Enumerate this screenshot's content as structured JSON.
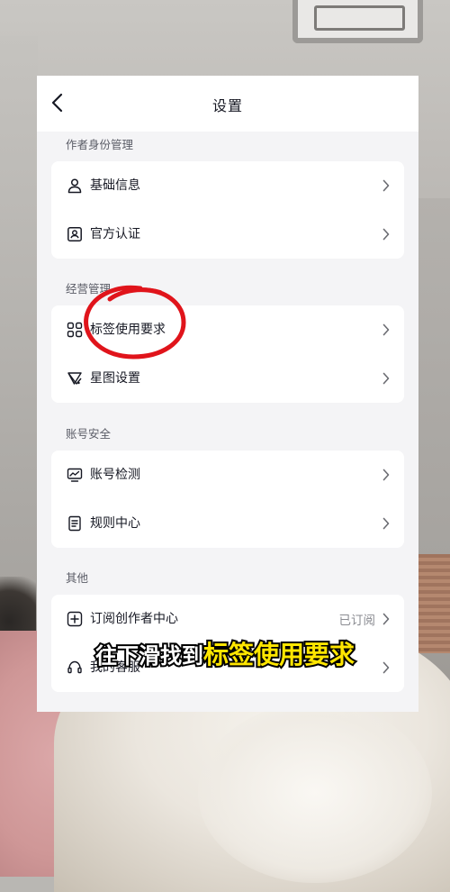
{
  "nav": {
    "title": "设置"
  },
  "sections": {
    "creator": {
      "label": "作者身份管理",
      "items": [
        {
          "label": "基础信息",
          "icon": "user-icon"
        },
        {
          "label": "官方认证",
          "icon": "id-badge-icon"
        }
      ]
    },
    "business": {
      "label": "经营管理",
      "items": [
        {
          "label": "标签使用要求",
          "icon": "grid-apps-icon"
        },
        {
          "label": "星图设置",
          "icon": "star-map-icon"
        }
      ]
    },
    "account": {
      "label": "账号安全",
      "items": [
        {
          "label": "账号检测",
          "icon": "monitor-chart-icon"
        },
        {
          "label": "规则中心",
          "icon": "document-icon"
        }
      ]
    },
    "other": {
      "label": "其他",
      "items": [
        {
          "label": "订阅创作者中心",
          "icon": "plus-square-icon",
          "value": "已订阅"
        },
        {
          "label": "我的客服",
          "icon": "headset-icon"
        }
      ]
    }
  },
  "overlay": {
    "caption_white": "往下滑找到",
    "caption_yellow": "标签使用要求",
    "highlight_color": "#e0141b",
    "caption_yellow_color": "#ffe600"
  }
}
